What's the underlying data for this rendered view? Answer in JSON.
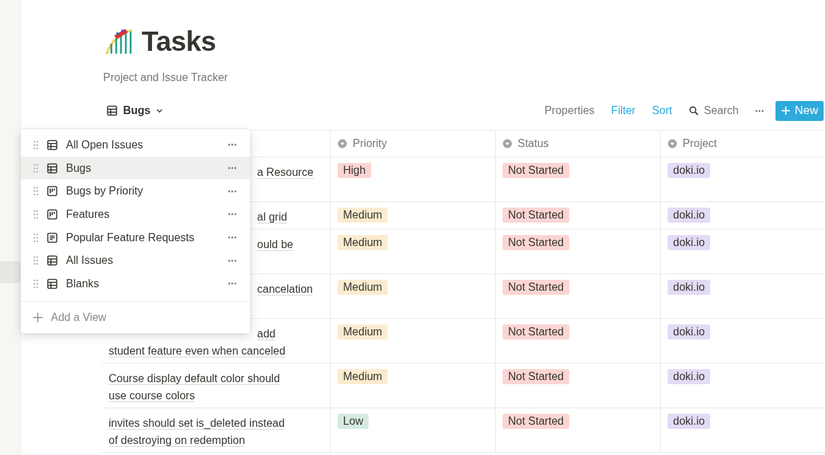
{
  "page": {
    "title": "Tasks",
    "subtitle": "Project and Issue Tracker"
  },
  "view_switcher": {
    "label": "Bugs",
    "kind": "table"
  },
  "toolbar": [
    {
      "label": "Properties",
      "kind": "plain"
    },
    {
      "label": "Filter",
      "kind": "accent"
    },
    {
      "label": "Sort",
      "kind": "accent"
    },
    {
      "label": "Search",
      "kind": "search"
    },
    {
      "label": "•••",
      "kind": "more"
    }
  ],
  "new_button": {
    "label": "New"
  },
  "table": {
    "columns": [
      {
        "kind": "name"
      },
      {
        "label": "Priority",
        "kind": "select"
      },
      {
        "label": "Status",
        "kind": "select"
      },
      {
        "label": "Project",
        "kind": "select"
      }
    ],
    "rows": [
      {
        "name": [
          {
            "text": "a Resource",
            "covered": true
          }
        ],
        "tall": true,
        "priority": {
          "text": "High",
          "color": "#fbd5d3"
        },
        "status": {
          "text": "Not Started",
          "color": "#fbd5d3"
        },
        "project": {
          "text": "doki.io",
          "color": "#e3dbf5"
        }
      },
      {
        "name": [
          {
            "text": "al grid",
            "covered": true
          }
        ],
        "tall": false,
        "priority": {
          "text": "Medium",
          "color": "#fbecd0"
        },
        "status": {
          "text": "Not Started",
          "color": "#fbd5d3"
        },
        "project": {
          "text": "doki.io",
          "color": "#e3dbf5"
        }
      },
      {
        "name": [
          {
            "text": "ould be",
            "covered": true
          }
        ],
        "tall": true,
        "priority": {
          "text": "Medium",
          "color": "#fbecd0"
        },
        "status": {
          "text": "Not Started",
          "color": "#fbd5d3"
        },
        "project": {
          "text": "doki.io",
          "color": "#e3dbf5"
        }
      },
      {
        "name": [
          {
            "text": "cancelation",
            "covered": true
          }
        ],
        "tall": true,
        "priority": {
          "text": "Medium",
          "color": "#fbecd0"
        },
        "status": {
          "text": "Not Started",
          "color": "#fbd5d3"
        },
        "project": {
          "text": "doki.io",
          "color": "#e3dbf5"
        }
      },
      {
        "name": [
          {
            "text": "add",
            "covered": true
          },
          {
            "text": "student feature even when canceled",
            "covered": false
          }
        ],
        "tall": true,
        "priority": {
          "text": "Medium",
          "color": "#fbecd0"
        },
        "status": {
          "text": "Not Started",
          "color": "#fbd5d3"
        },
        "project": {
          "text": "doki.io",
          "color": "#e3dbf5"
        }
      },
      {
        "name": [
          {
            "text": "Course display default color should",
            "covered": false
          },
          {
            "text": "use course colors",
            "covered": false
          }
        ],
        "tall": true,
        "priority": {
          "text": "Medium",
          "color": "#fbecd0"
        },
        "status": {
          "text": "Not Started",
          "color": "#fbd5d3"
        },
        "project": {
          "text": "doki.io",
          "color": "#e3dbf5"
        }
      },
      {
        "name": [
          {
            "text": "invites should set is_deleted instead",
            "covered": false
          },
          {
            "text": "of destroying on redemption",
            "covered": false
          }
        ],
        "tall": true,
        "priority": {
          "text": "Low",
          "color": "#d5ebe1"
        },
        "status": {
          "text": "Not Started",
          "color": "#fbd5d3"
        },
        "project": {
          "text": "doki.io",
          "color": "#e3dbf5"
        }
      }
    ]
  },
  "views_menu": {
    "items": [
      {
        "label": "All Open Issues",
        "kind": "table",
        "selected": false
      },
      {
        "label": "Bugs",
        "kind": "table",
        "selected": true
      },
      {
        "label": "Bugs by Priority",
        "kind": "board",
        "selected": false
      },
      {
        "label": "Features",
        "kind": "board",
        "selected": false
      },
      {
        "label": "Popular Feature Requests",
        "kind": "list",
        "selected": false
      },
      {
        "label": "All Issues",
        "kind": "table",
        "selected": false
      },
      {
        "label": "Blanks",
        "kind": "table",
        "selected": false
      }
    ],
    "more_label": "•••",
    "add_label": "Add a View"
  }
}
